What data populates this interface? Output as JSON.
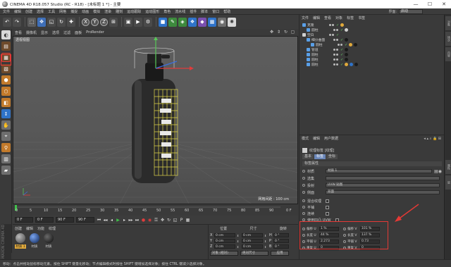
{
  "window": {
    "title": "CINEMA 4D R18.057 Studio (RC - R18) - [未标题 1 *] - 主要",
    "minimize": "—",
    "maximize": "☐",
    "close": "✕"
  },
  "menubar": {
    "items": [
      "文件",
      "编辑",
      "创建",
      "选择",
      "工具",
      "网格",
      "捕捉",
      "动画",
      "模拟",
      "渲染",
      "雕刻",
      "运动跟踪",
      "运动图形",
      "角色",
      "流水线",
      "插件",
      "脚本",
      "窗口",
      "帮助"
    ],
    "layout_label": "界面:",
    "layout_value": "启动"
  },
  "viewport": {
    "menu": [
      "查看",
      "摄像机",
      "显示",
      "选项",
      "过滤",
      "面板",
      "ProRender"
    ],
    "label": "透视视图",
    "grid_scale": "网格间距 : 100 cm"
  },
  "timeline": {
    "ticks": [
      "0",
      "5",
      "10",
      "15",
      "20",
      "25",
      "30",
      "35",
      "40",
      "45",
      "50",
      "55",
      "60",
      "65",
      "70",
      "75",
      "80",
      "85",
      "90"
    ],
    "end_label": "0 F",
    "current_frame": "0 F",
    "start_frame": "0 F",
    "end_frame": "90 F",
    "max_frame": "90 F"
  },
  "materials": {
    "menu": [
      "创建",
      "编辑",
      "功能",
      "纹理"
    ],
    "items": [
      {
        "label": "材质 1",
        "color": "#6e6e6e"
      },
      {
        "label": "材质",
        "color": "#1c3a78"
      },
      {
        "label": "材质",
        "color": "#1a1a1a"
      }
    ],
    "maxon": "MAXON CINEMA 4D"
  },
  "coordinates": {
    "headers": [
      "位置",
      "尺寸",
      "旋转"
    ],
    "rows": [
      {
        "axis": "X",
        "pos": "0 cm",
        "size": "0 cm",
        "rot_axis": "H",
        "rot": "0 °"
      },
      {
        "axis": "Y",
        "pos": "0 cm",
        "size": "0 cm",
        "rot_axis": "P",
        "rot": "0 °"
      },
      {
        "axis": "Z",
        "pos": "0 cm",
        "size": "0 cm",
        "rot_axis": "B",
        "rot": "0 °"
      }
    ],
    "mode": "对象 (相对)",
    "size_mode": "绝对尺寸",
    "apply": "应用"
  },
  "statusbar": {
    "text": "移动：点击并拖动鼠标移动元素。按住 SHIFT 键量化移动；节点编辑模式时按住 SHIFT 键增加选择对象；按住 CTRL 键减少选择对象。"
  },
  "object_manager": {
    "menu": [
      "文件",
      "编辑",
      "查看",
      "对象",
      "标签",
      "书签"
    ],
    "objects": [
      {
        "name": "克隆",
        "indent": 0,
        "color": "#5aa0e8"
      },
      {
        "name": "圆柱",
        "indent": 1,
        "color": "#5aa0e8"
      },
      {
        "name": "空白",
        "indent": 0,
        "color": "#cfcfcf"
      },
      {
        "name": "细分曲面",
        "indent": 1,
        "color": "#5aa0e8"
      },
      {
        "name": "圆柱",
        "indent": 2,
        "color": "#5aa0e8"
      },
      {
        "name": "管道",
        "indent": 1,
        "color": "#5aa0e8"
      },
      {
        "name": "圆柱",
        "indent": 1,
        "color": "#5aa0e8"
      },
      {
        "name": "圆柱",
        "indent": 1,
        "color": "#5aa0e8"
      },
      {
        "name": "圆柱",
        "indent": 1,
        "color": "#5aa0e8"
      }
    ]
  },
  "attribute_manager": {
    "menu": [
      "模式",
      "编辑",
      "用户数据"
    ],
    "tag_title": "纹理标签 [纹理]",
    "tabs": [
      "基本",
      "标签",
      "坐标"
    ],
    "active_tab": "标签",
    "section": "标签属性",
    "fields": [
      {
        "label": "材质",
        "value": "材质 1"
      },
      {
        "label": "选集",
        "value": ""
      },
      {
        "label": "投射",
        "value": "UVW 贴图"
      },
      {
        "label": "侧面",
        "value": "双面"
      },
      {
        "label": "混合纹理",
        "value": ""
      },
      {
        "label": "平铺",
        "value": ""
      },
      {
        "label": "连续",
        "value": ""
      },
      {
        "label": "使用凹凸 UVW",
        "value": ""
      }
    ],
    "uv": [
      {
        "l1": "偏移 U",
        "v1": "1 %",
        "l2": "偏移 V",
        "v2": "101 %"
      },
      {
        "l1": "长度 U",
        "v1": "44 %",
        "l2": "长度 V",
        "v2": "137 %"
      },
      {
        "l1": "平铺 U",
        "v1": "2.273",
        "l2": "平铺 V",
        "v2": "0.73"
      },
      {
        "l1": "重复 U",
        "v1": "0",
        "l2": "重复 V",
        "v2": "0"
      }
    ]
  },
  "colors": {
    "accent": "#6a86b8",
    "annotation": "#e53935",
    "check": "#69d36a"
  }
}
